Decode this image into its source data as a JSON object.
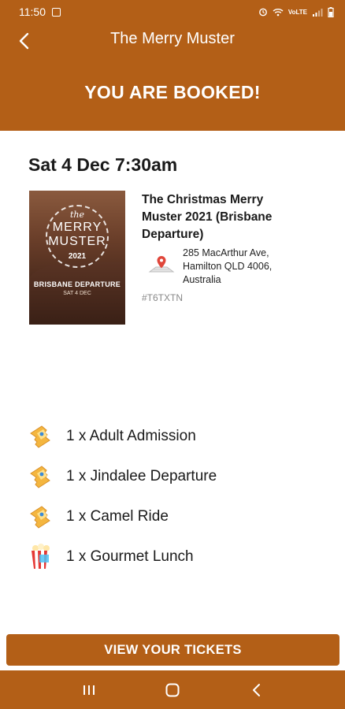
{
  "status_bar": {
    "time": "11:50",
    "network": "VoLTE"
  },
  "header": {
    "app_title": "The Merry Muster",
    "booked_title": "YOU ARE BOOKED!"
  },
  "booking": {
    "date_time": "Sat 4 Dec 7:30am",
    "event_name": "The Christmas Merry Muster 2021 (Brisbane Departure)",
    "address": "285 MacArthur Ave, Hamilton QLD 4006, Australia",
    "booking_code": "#T6TXTN",
    "image": {
      "the": "the",
      "merry": "MERRY",
      "muster": "MUSTER",
      "year": "2021",
      "departure": "BRISBANE DEPARTURE",
      "date": "SAT 4 DEC"
    }
  },
  "items": [
    {
      "label": "1 x Adult Admission",
      "icon": "ticket-icon"
    },
    {
      "label": "1 x Jindalee Departure",
      "icon": "ticket-icon"
    },
    {
      "label": "1 x Camel Ride",
      "icon": "ticket-icon"
    },
    {
      "label": "1 x Gourmet Lunch",
      "icon": "popcorn-icon"
    }
  ],
  "actions": {
    "view_tickets": "VIEW YOUR TICKETS"
  },
  "colors": {
    "brand": "#b35f17"
  }
}
